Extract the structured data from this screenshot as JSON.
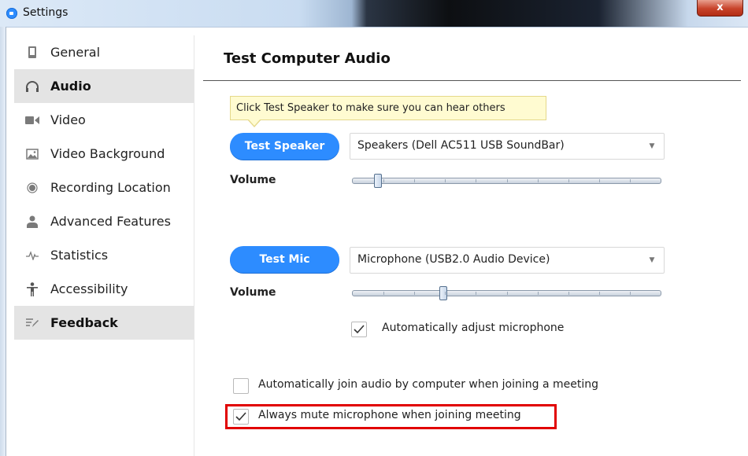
{
  "window": {
    "title": "Settings",
    "close_label": "x"
  },
  "sidebar": {
    "items": [
      {
        "label": "General",
        "icon": "tablet-icon",
        "selected": false
      },
      {
        "label": "Audio",
        "icon": "headphones-icon",
        "selected": true
      },
      {
        "label": "Video",
        "icon": "video-camera-icon",
        "selected": false
      },
      {
        "label": "Video Background",
        "icon": "image-icon",
        "selected": false
      },
      {
        "label": "Recording Location",
        "icon": "record-icon",
        "selected": false
      },
      {
        "label": "Advanced Features",
        "icon": "person-icon",
        "selected": false
      },
      {
        "label": "Statistics",
        "icon": "pulse-icon",
        "selected": false
      },
      {
        "label": "Accessibility",
        "icon": "accessibility-icon",
        "selected": false
      },
      {
        "label": "Feedback",
        "icon": "feedback-icon",
        "selected": false
      }
    ]
  },
  "main": {
    "title": "Test Computer Audio",
    "speaker": {
      "tooltip": "Click Test Speaker to make sure you can hear others",
      "test_button": "Test Speaker",
      "device": "Speakers (Dell AC511 USB SoundBar)",
      "volume_label": "Volume",
      "volume_level": 0.07
    },
    "mic": {
      "test_button": "Test Mic",
      "device": "Microphone (USB2.0 Audio Device)",
      "volume_label": "Volume",
      "volume_level": 0.29,
      "auto_adjust_label": "Automatically adjust microphone",
      "auto_adjust_checked": true
    },
    "options": {
      "auto_join_label": "Automatically join audio by computer when joining a meeting",
      "auto_join_checked": false,
      "always_mute_label": "Always mute microphone when joining meeting",
      "always_mute_checked": true
    }
  },
  "colors": {
    "accent": "#2d8cff",
    "highlight": "#e10000",
    "tooltip_bg": "#fffbd1"
  }
}
